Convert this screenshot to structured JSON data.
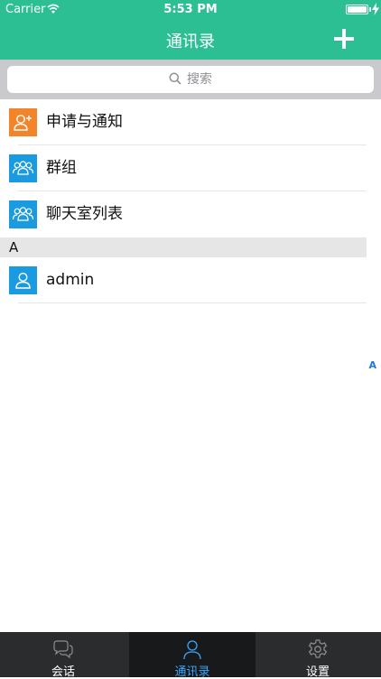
{
  "status_bar": {
    "carrier": "Carrier",
    "time": "5:53 PM"
  },
  "nav": {
    "title": "通讯录",
    "add_icon": "plus-icon"
  },
  "search": {
    "placeholder": "搜索"
  },
  "list": {
    "top_items": [
      {
        "label": "申请与通知",
        "icon": "add-contact-icon",
        "icon_color": "#f2852a"
      },
      {
        "label": "群组",
        "icon": "group-icon",
        "icon_color": "#1a9be0"
      },
      {
        "label": "聊天室列表",
        "icon": "group-icon",
        "icon_color": "#1a9be0"
      }
    ],
    "sections": [
      {
        "title": "A",
        "items": [
          {
            "label": "admin",
            "icon": "contact-icon",
            "icon_color": "#1a9be0"
          }
        ]
      }
    ]
  },
  "index": [
    "A"
  ],
  "tabs": [
    {
      "label": "会话",
      "icon": "chat-icon",
      "active": false
    },
    {
      "label": "通讯录",
      "icon": "contacts-icon",
      "active": true
    },
    {
      "label": "设置",
      "icon": "gear-icon",
      "active": false
    }
  ],
  "colors": {
    "primary": "#2bbf93",
    "orange": "#f2852a",
    "blue": "#1a9be0",
    "tab_active": "#39a7ff",
    "tabbar": "#2a2c2e"
  }
}
